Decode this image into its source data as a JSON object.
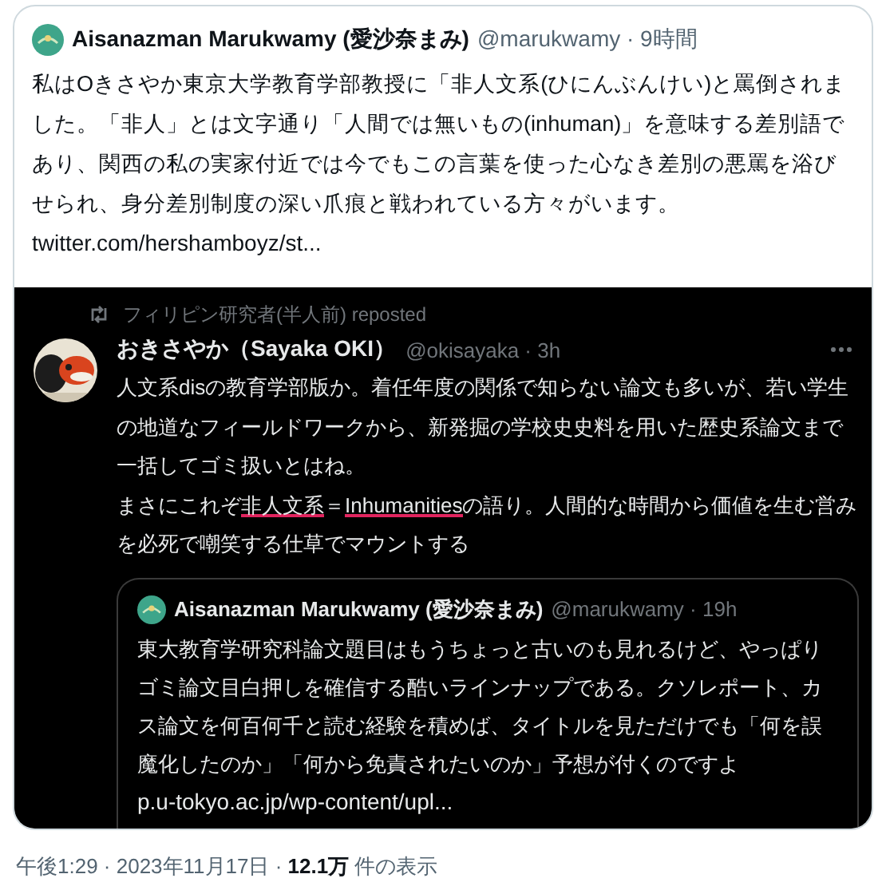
{
  "tweet": {
    "author": "Aisanazman Marukwamy (愛沙奈まみ)",
    "handle_time": "@marukwamy · 9時間",
    "text": "私はOきさやか東京大学教育学部教授に「非人文系(ひにんぶんけい)と罵倒されました。「非人」とは文字通り「人間では無いもの(inhuman)」を意味する差別語であり、関西の私の実家付近では今でもこの言葉を使った心なき差別の悪罵を浴びせられ、身分差別制度の深い爪痕と戦われている方々がいます。",
    "link": "twitter.com/hershamboyz/st..."
  },
  "embedded_screenshot": {
    "repost_label": "フィリピン研究者(半人前) reposted",
    "author": "おきさやか（Sayaka OKI）",
    "handle_time": "@okisayaka · 3h",
    "paragraphs": [
      {
        "segments": [
          {
            "text": "人文系disの教育学部版か。着任年度の関係で知らない論文も多いが、若い学生の地道なフィールドワークから、新発掘の学校史史料を用いた歴史系論文まで一括してゴミ扱いとはね。",
            "underlined": false
          }
        ]
      },
      {
        "segments": [
          {
            "text": "まさにこれぞ",
            "underlined": false
          },
          {
            "text": "非人文系",
            "underlined": true
          },
          {
            "text": "＝",
            "underlined": false
          },
          {
            "text": "Inhumanities",
            "underlined": true
          },
          {
            "text": "の語り。人間的な時間から価値を生む営みを必死で嘲笑する仕草でマウントする",
            "underlined": false
          }
        ]
      }
    ],
    "quote": {
      "author": "Aisanazman Marukwamy (愛沙奈まみ)",
      "handle_time": "@marukwamy · 19h",
      "text": "東大教育学研究科論文題目はもうちょっと古いのも見れるけど、やっぱりゴミ論文目白押しを確信する酷いラインナップである。クソレポート、カス論文を何百何千と読む経験を積めば、タイトルを見ただけでも「何を誤魔化したのか」「何から免責されたいのか」予想が付くのですよ",
      "link": "p.u-tokyo.ac.jp/wp-content/upl..."
    }
  },
  "meta": "午後1:29 · 2023年11月17日 · **12.1万** 件の表示"
}
